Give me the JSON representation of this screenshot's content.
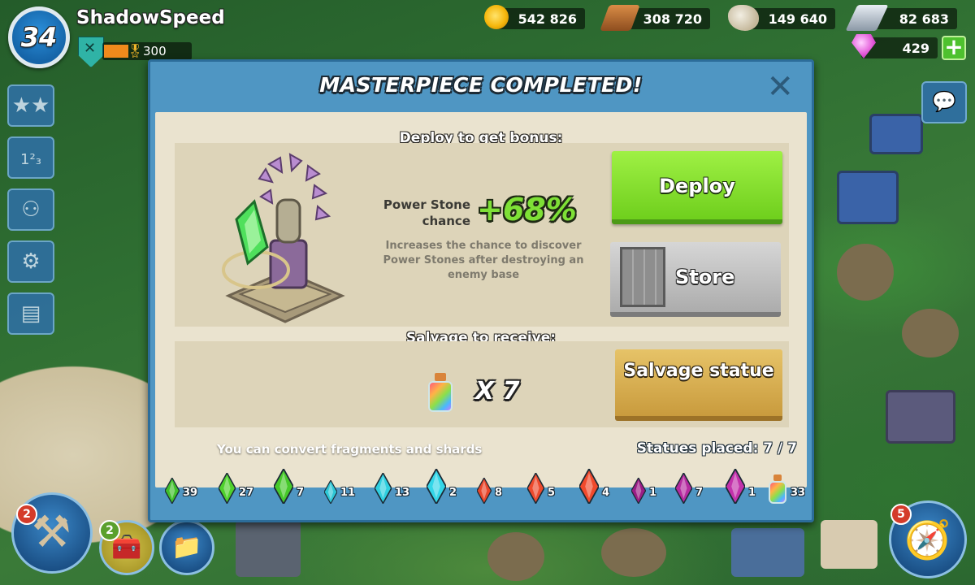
{
  "player": {
    "level": "34",
    "name": "ShadowSpeed",
    "victory_points": "300"
  },
  "resources": {
    "gold": "542 826",
    "wood": "308 720",
    "stone": "149 640",
    "iron": "82 683",
    "diamonds": "429"
  },
  "dialog": {
    "title": "MASTERPIECE COMPLETED!",
    "deploy_header": "Deploy to get bonus:",
    "bonus_name": "Power Stone chance",
    "bonus_value": "+68%",
    "bonus_description": "Increases the chance to discover Power Stones after destroying an enemy base",
    "deploy_button": "Deploy",
    "store_button": "Store",
    "salvage_header": "Salvage to receive:",
    "salvage_quantity": "X 7",
    "salvage_button": "Salvage statue",
    "convert_text": "You can convert fragments and shards",
    "statues_placed": "Statues placed: 7 / 7"
  },
  "fragments": [
    {
      "name": "life-fragment-icon",
      "count": "39",
      "color": "#3fbf2a"
    },
    {
      "name": "life-shard-icon",
      "count": "27",
      "color": "#4fd12c"
    },
    {
      "name": "life-crystal-icon",
      "count": "7",
      "color": "#47c92b"
    },
    {
      "name": "ice-fragment-icon",
      "count": "11",
      "color": "#2ec7d6"
    },
    {
      "name": "ice-shard-icon",
      "count": "13",
      "color": "#2fcfe0"
    },
    {
      "name": "ice-crystal-icon",
      "count": "2",
      "color": "#33d6e8"
    },
    {
      "name": "magma-fragment-icon",
      "count": "8",
      "color": "#e8452a"
    },
    {
      "name": "magma-shard-icon",
      "count": "5",
      "color": "#ee4a2d"
    },
    {
      "name": "magma-crystal-icon",
      "count": "4",
      "color": "#f04a2c"
    },
    {
      "name": "dark-fragment-icon",
      "count": "1",
      "color": "#9a1d86"
    },
    {
      "name": "dark-shard-icon",
      "count": "7",
      "color": "#b52aa0"
    },
    {
      "name": "dark-crystal-icon",
      "count": "1",
      "color": "#c332ab"
    },
    {
      "name": "elixir-potion-icon",
      "count": "33",
      "color": "#8be04a"
    }
  ],
  "badges": {
    "builder_count": "2",
    "chest_count": "2",
    "map_count": "5"
  },
  "colors": {
    "panel_blue": "#4f96c3",
    "deploy_green": "#7ee036",
    "salvage_gold": "#d9b052"
  }
}
